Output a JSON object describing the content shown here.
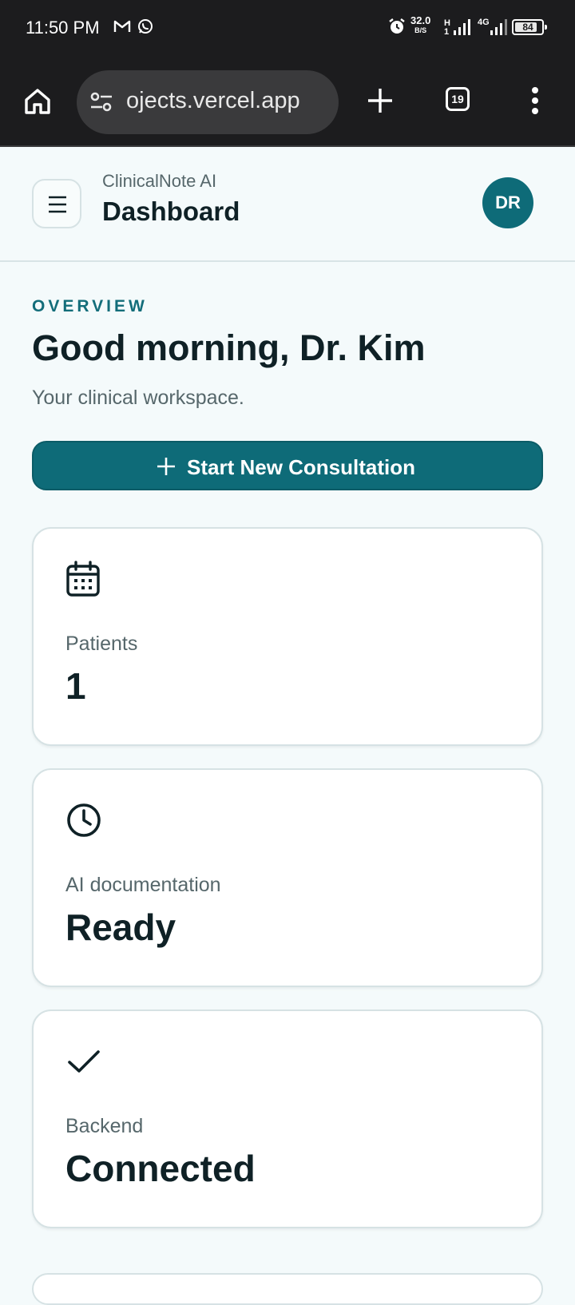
{
  "status_bar": {
    "time": "11:50 PM",
    "net_speed_value": "32.0",
    "net_speed_unit": "B/S",
    "h_label": "H",
    "h_sub": "1",
    "network_label": "4G",
    "battery_level": "84",
    "battery_fraction": 0.84,
    "icons": [
      "gmail-icon",
      "whatsapp-icon",
      "alarm-icon",
      "signal-icon",
      "battery-icon"
    ]
  },
  "browser": {
    "url": "ojects.vercel.app",
    "tab_count": "19",
    "icons": [
      "home-icon",
      "site-settings-icon",
      "new-tab-icon",
      "tabs-icon",
      "more-icon"
    ]
  },
  "header": {
    "app_name": "ClinicalNote AI",
    "page_title": "Dashboard",
    "avatar_initials": "DR"
  },
  "overview": {
    "overline": "OVERVIEW",
    "greeting": "Good morning, Dr. Kim",
    "subtitle": "Your clinical workspace."
  },
  "cta": {
    "label": "Start New Consultation"
  },
  "cards": [
    {
      "icon": "calendar-icon",
      "label": "Patients",
      "value": "1"
    },
    {
      "icon": "clock-icon",
      "label": "AI documentation",
      "value": "Ready"
    },
    {
      "icon": "check-icon",
      "label": "Backend",
      "value": "Connected"
    }
  ],
  "colors": {
    "accent": "#0e6b78",
    "page_bg": "#f4fafb",
    "text_primary": "#0f2126",
    "text_secondary": "#56676b"
  }
}
